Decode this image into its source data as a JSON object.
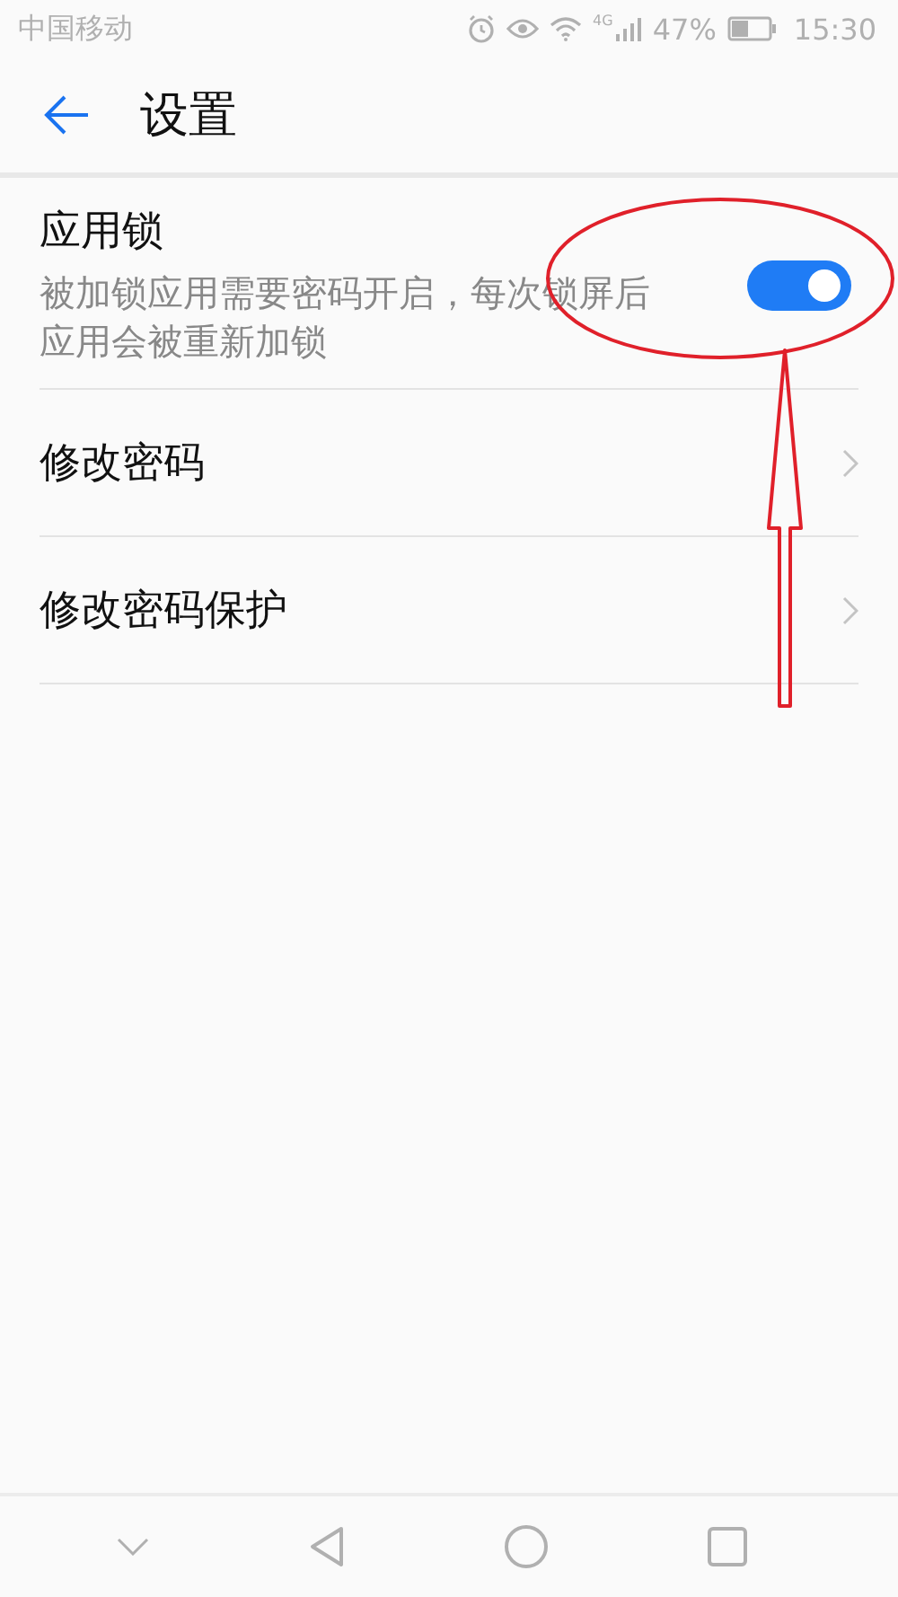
{
  "status_bar": {
    "carrier": "中国移动",
    "network": "4G",
    "battery": "47%",
    "time": "15:30"
  },
  "header": {
    "title": "设置"
  },
  "rows": [
    {
      "kind": "toggle",
      "title": "应用锁",
      "subtitle": "被加锁应用需要密码开启，每次锁屏后应用会被重新加锁",
      "on": true
    },
    {
      "kind": "link",
      "title": "修改密码"
    },
    {
      "kind": "link",
      "title": "修改密码保护"
    }
  ],
  "annotation": {
    "kind": "circle-and-arrow"
  }
}
